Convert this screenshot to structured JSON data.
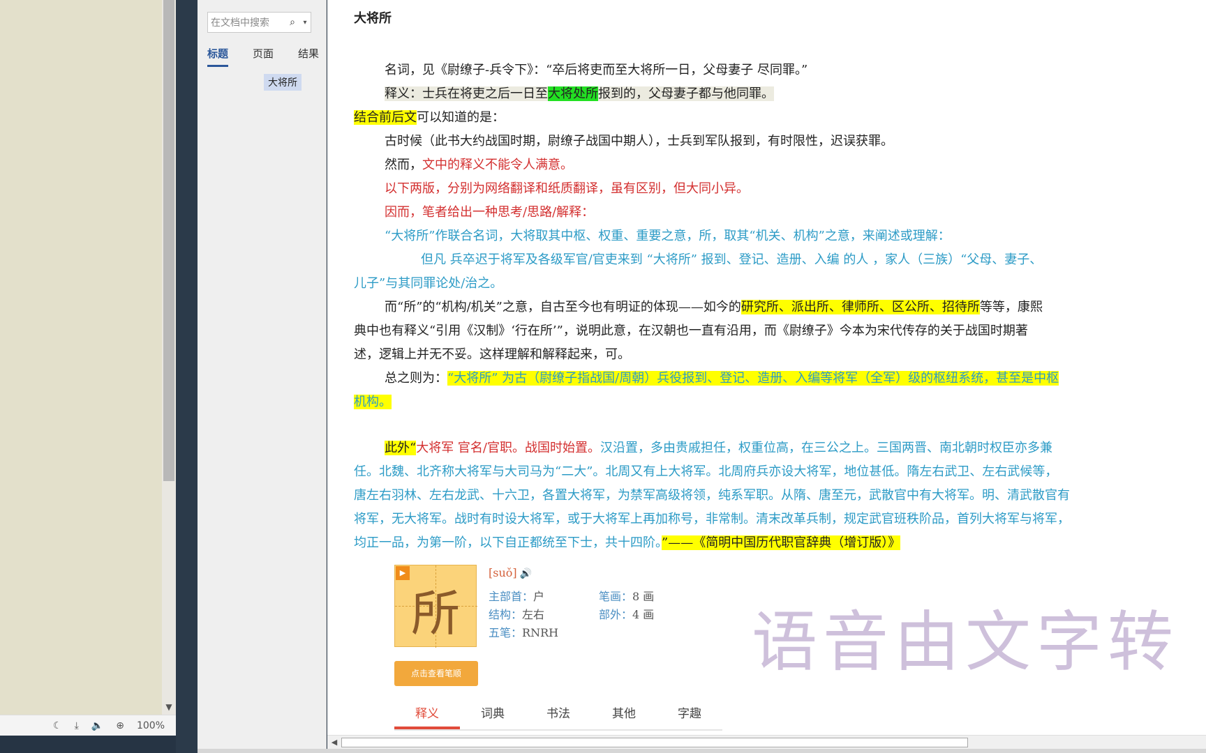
{
  "status_bar": {
    "zoom": "100%",
    "icons": [
      "moon-icon",
      "download-icon",
      "speaker-icon",
      "zoom-in-icon"
    ]
  },
  "nav": {
    "search_placeholder": "在文档中搜索",
    "tabs": [
      {
        "label": "标题",
        "active": true
      },
      {
        "label": "页面",
        "active": false
      },
      {
        "label": "结果",
        "active": false
      }
    ],
    "headings": [
      "大将所"
    ]
  },
  "doc": {
    "title": "大将所",
    "p1": "名词，见《尉缭子-兵令下》：“卒后将吏而至大将所一日，父母妻子 尽同罪。”",
    "p2": {
      "a": "释义：士兵在将吏之后一日至",
      "b": "大将处所",
      "c": "报到的，父母妻子都与他同罪。"
    },
    "p3": {
      "a": "结合前后文",
      "b": "可以知道的是："
    },
    "p4": "古时候（此书大约战国时期，尉缭子战国中期人），士兵到军队报到，有时限性，迟误获罪。",
    "p5": {
      "a": "然而，",
      "b": "文中的释义不能令人满意。"
    },
    "p6": "以下两版，分别为网络翻译和纸质翻译，虽有区别，但大同小异。",
    "p7": "因而，笔者给出一种思考/思路/解释：",
    "p8": "“大将所”作联合名词，大将取其中枢、权重、重要之意，所，取其“机关、机构”之意，来阐述或理解：",
    "p9": "但凡 兵卒迟于将军及各级军官/官吏来到  “大将所” 报到、登记、造册、入编 的人 ，家人（三族）“父母、妻子、",
    "p10": "儿子”与其同罪论处/治之。",
    "p11": {
      "a": "而“所”的“机构/机关”之意，自古至今也有明证的体现——如今的",
      "b": "研究所、派出所、律师所、区公所、招待所",
      "c": "等等，康熙"
    },
    "p12": "典中也有释义“引用《汉制》‘行在所’”，说明此意，在汉朝也一直有沿用，而《尉缭子》今本为宋代传存的关于战国时期著",
    "p13": "述，逻辑上并无不妥。这样理解和解释起来，可。",
    "p14": {
      "a": "总之则为：",
      "b": "“大将所” 为古（尉缭子指战国/周朝）兵役报到、登记、造册、入编等将军（全军）级的枢纽系统，甚至是中枢"
    },
    "p15": "机构。",
    "p16": {
      "a": "此外“",
      "b": "大将军  官名/官职。战国时始置。",
      "c": "汉沿置，多由贵戚担任，权重位高，在三公之上。三国两晋、南北朝时权臣亦多兼"
    },
    "p17": "任。北魏、北齐称大将军与大司马为“二大”。北周又有上大将军。北周府兵亦设大将军，地位甚低。隋左右武卫、左右武候等，",
    "p18": "唐左右羽林、左右龙武、十六卫，各置大将军，为禁军高级将领，纯系军职。从隋、唐至元，武散官中有大将军。明、清武散官有",
    "p19": "将军，无大将军。战时有时设大将军，或于大将军上再加称号，非常制。清末改革兵制，规定武官班秩阶品，首列大将军与将军，",
    "p20": {
      "a": "均正一品，为第一阶，以下自正都统至下士，共十四阶。",
      "b": "”——《简明中国历代职官辞典（增订版）》"
    }
  },
  "dict": {
    "char": "所",
    "pinyin": "[suǒ]",
    "radical_label": "主部首：",
    "radical": "户",
    "strokes_label": "笔画：",
    "strokes": "8 画",
    "structure_label": "结构：",
    "structure": "左右",
    "outside_label": "部外：",
    "outside": "4 画",
    "wubi_label": "五笔：",
    "wubi": "RNRH",
    "stroke_button": "点击查看笔顺",
    "tabs": [
      {
        "label": "释义",
        "active": true
      },
      {
        "label": "词典",
        "active": false
      },
      {
        "label": "书法",
        "active": false
      },
      {
        "label": "其他",
        "active": false
      },
      {
        "label": "字趣",
        "active": false
      }
    ]
  },
  "watermark": "语音由文字转",
  "colors": {
    "red": "#d32f2f",
    "blue": "#2c9bc6",
    "highlight_yellow": "#ffff00",
    "highlight_green": "#22e022",
    "accent": "#2b579a"
  }
}
